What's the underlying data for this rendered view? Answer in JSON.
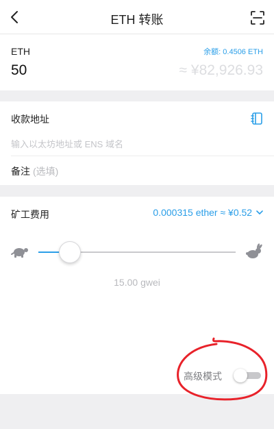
{
  "header": {
    "title": "ETH 转账",
    "back_icon": "chevron-left-icon",
    "scan_icon": "scan-icon"
  },
  "amount": {
    "currency": "ETH",
    "balance_label": "余额: 0.4506 ETH",
    "value": "50",
    "fiat_estimate": "≈ ¥82,926.93"
  },
  "recipient": {
    "label": "收款地址",
    "placeholder": "输入以太坊地址或 ENS 域名",
    "address_book_icon": "address-book-icon",
    "memo_label": "备注",
    "memo_optional": "(选填)"
  },
  "fee": {
    "label": "矿工费用",
    "value": "0.000315 ether ≈ ¥0.52",
    "slider_level": 0.16,
    "gas_price": "15.00 gwei",
    "slow_icon": "turtle-icon",
    "fast_icon": "rabbit-icon",
    "advanced_label": "高级模式",
    "advanced_enabled": false
  },
  "colors": {
    "accent": "#2a9ee8",
    "annotation": "#e8222a"
  }
}
